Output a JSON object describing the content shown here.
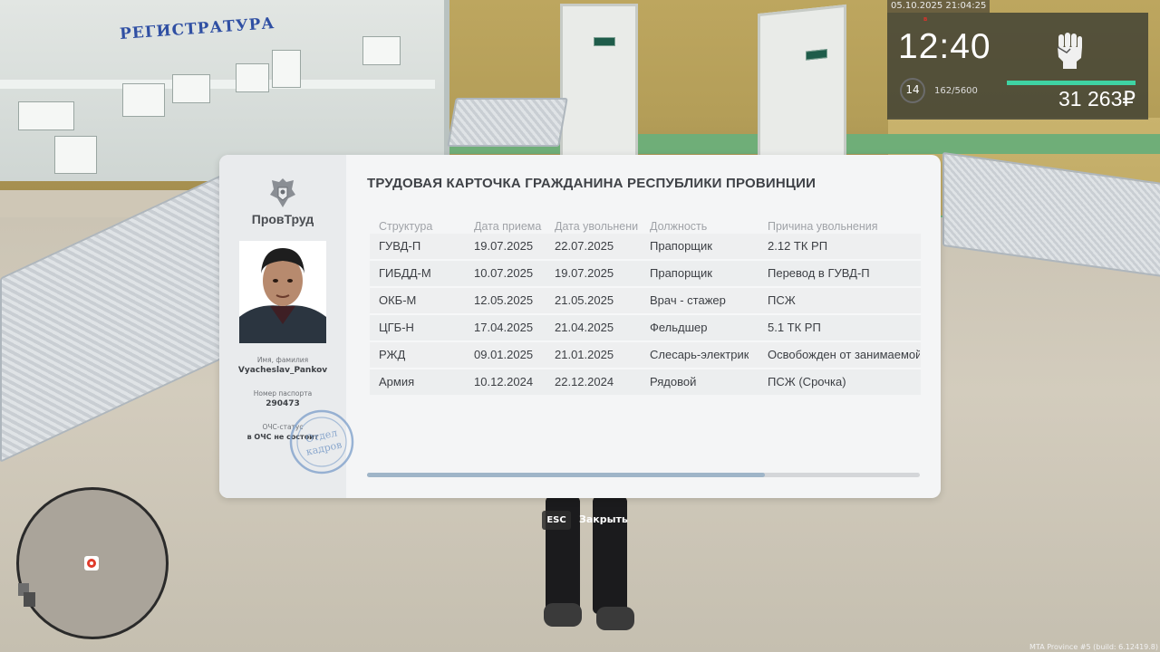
{
  "background": {
    "reception_sign": "РЕГИСТРАТУРА"
  },
  "hud": {
    "datetime": "05.10.2025 21:04:25",
    "clock": "12:40",
    "level": "14",
    "experience": "162/5600",
    "money": "31 263₽",
    "health_fraction": 1.0,
    "icons": [
      "fist-icon",
      "level-ring-icon"
    ]
  },
  "card": {
    "org_name": "ПровТруд",
    "title": "ТРУДОВАЯ КАРТОЧКА ГРАЖДАНИНА РЕСПУБЛИКИ ПРОВИНЦИИ",
    "name_label": "Имя, фамилия",
    "name_value": "Vyacheslav_Pankov",
    "passport_label": "Номер паспорта",
    "passport_value": "290473",
    "status_label": "ОЧС-статус",
    "status_value": "в ОЧС не состоит",
    "stamp_text_top": "Отдел",
    "stamp_text_bottom": "кадров",
    "columns": [
      "Структура",
      "Дата приема",
      "Дата увольнени",
      "Должность",
      "Причина увольнения"
    ],
    "rows": [
      [
        "ГУВД-П",
        "19.07.2025",
        "22.07.2025",
        "Прапорщик",
        "2.12 ТК РП"
      ],
      [
        "ГИБДД-М",
        "10.07.2025",
        "19.07.2025",
        "Прапорщик",
        "Перевод в ГУВД-П"
      ],
      [
        "ОКБ-М",
        "12.05.2025",
        "21.05.2025",
        "Врач - стажер",
        "ПСЖ"
      ],
      [
        "ЦГБ-Н",
        "17.04.2025",
        "21.04.2025",
        "Фельдшер",
        "5.1 ТК РП"
      ],
      [
        "РЖД",
        "09.01.2025",
        "21.01.2025",
        "Слесарь-электрик",
        "Освобожден от занимаемой"
      ],
      [
        "Армия",
        "10.12.2024",
        "22.12.2024",
        "Рядовой",
        "ПСЖ (Срочка)"
      ]
    ],
    "scroll_fraction": 0.72
  },
  "close_hint": {
    "key": "ESC",
    "label": "Закрыть"
  },
  "build_info": "MTA Province #5 (build: 6.12419.8)",
  "colors": {
    "accent_green": "#3fd3a3",
    "card_bg": "#f4f5f6",
    "stamp_blue": "#7a9cc8"
  }
}
